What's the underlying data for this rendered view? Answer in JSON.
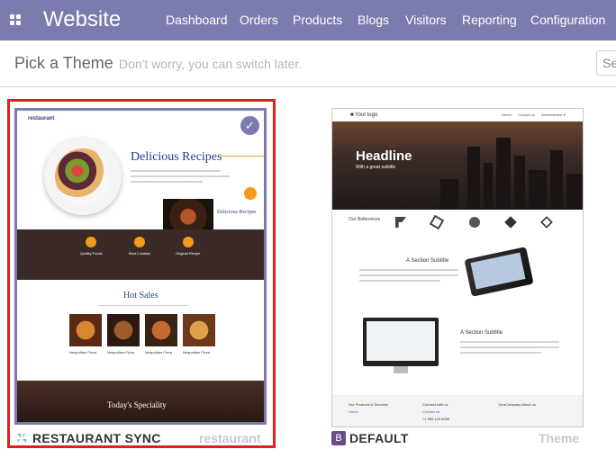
{
  "app": {
    "title": "Website"
  },
  "nav": [
    "Dashboard",
    "Orders",
    "Products",
    "Blogs",
    "Visitors",
    "Reporting",
    "Configuration"
  ],
  "header": {
    "title": "Pick a Theme",
    "hint": "Don't worry, you can switch later.",
    "search_value": "Se"
  },
  "themes": [
    {
      "name": "RESTAURANT SYNC",
      "tag": "restaurant",
      "selected": true,
      "preview": {
        "logo": "restaurant",
        "heading": "Delicious Recipes",
        "mini_heading": "Delicious Recipes",
        "features": [
          "Quality Foods",
          "Best Location",
          "Original Recipe"
        ],
        "section_title": "Hot Sales",
        "dishes": [
          "Neapolitan Pizza",
          "Neapolitan Pizza",
          "Neapolitan Pizza",
          "Neapolitan Pizza"
        ],
        "banner": "Today's Speciality"
      }
    },
    {
      "name": "DEFAULT",
      "tag": "Theme",
      "badge": "B",
      "selected": false,
      "preview": {
        "logo": "■ Your logo",
        "nav": [
          "Home",
          "Contact us",
          "Administrator ▾"
        ],
        "headline": "Headline",
        "subtitle": "With a great subtitle",
        "references": "Our References",
        "section1": "A Section Subtitle",
        "section2": "A Section Subtitle",
        "footer": [
          "Our Products & Services",
          "Connect with us",
          "YourCompany  About us"
        ],
        "footer_links": [
          "Home",
          "Contact us",
          "+1 555 123 8069"
        ]
      }
    }
  ],
  "colors": {
    "topbar": "#7c7bad",
    "selection_border": "#e11f1f",
    "accent": "#f39a1e"
  }
}
